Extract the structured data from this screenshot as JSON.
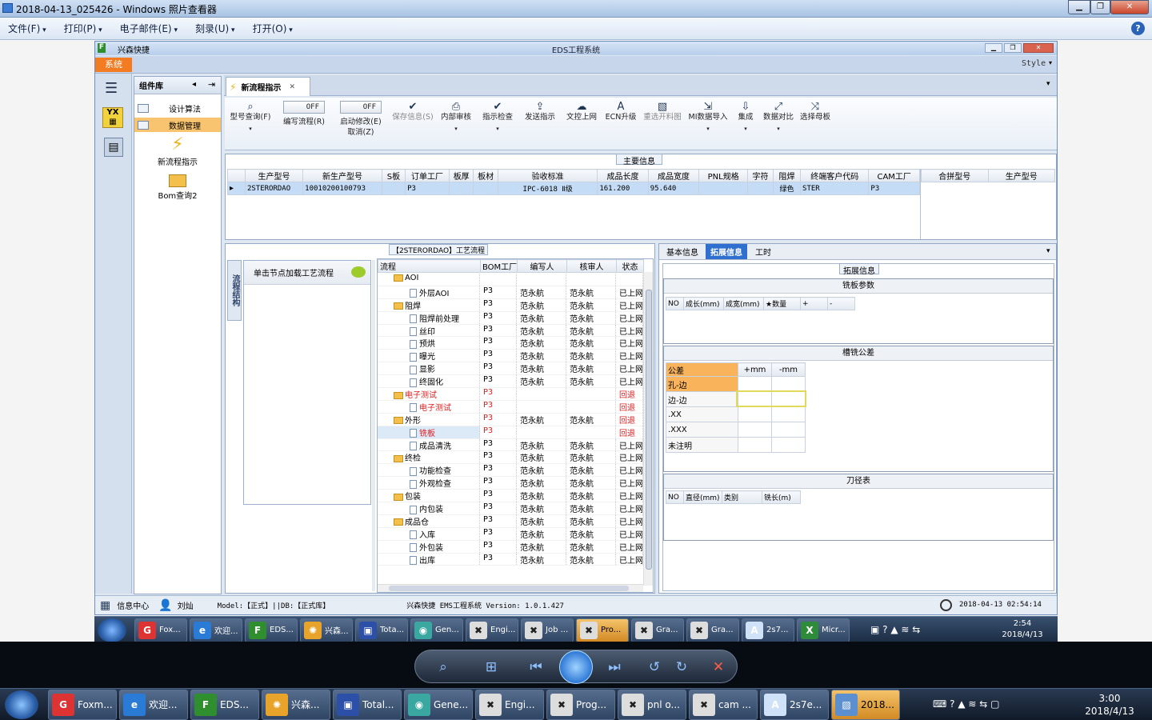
{
  "viewer": {
    "title": "2018-04-13_025426 - Windows 照片查看器",
    "menu": [
      "文件(F)",
      "打印(P)",
      "电子邮件(E)",
      "刻录(U)",
      "打开(O)"
    ],
    "help": "?"
  },
  "app": {
    "title": "EDS工程系统",
    "brand": "兴森快捷",
    "sys_tab": "系统",
    "style_label": "Style",
    "nav_title": "组件库",
    "nav_items": [
      "设计算法",
      "数据管理"
    ],
    "nav_tiles": [
      "新流程指示",
      "Bom查询2"
    ],
    "doc_tab": "新流程指示",
    "toolbar": [
      {
        "label": "型号查询(F)",
        "icon": "search-icon"
      },
      {
        "label": "编写流程(R)",
        "toggle": "OFF"
      },
      {
        "label": "启动修改(E)\n取消(Z)",
        "toggle": "OFF"
      },
      {
        "label": "保存信息(S)",
        "icon": "check-icon"
      },
      {
        "label": "内部审核",
        "icon": "print-icon"
      },
      {
        "label": "指示检查",
        "icon": "check-icon"
      },
      {
        "label": "发送指示",
        "icon": "upload-icon"
      },
      {
        "label": "文控上网",
        "icon": "cloud-icon"
      },
      {
        "label": "ECN升级",
        "icon": "font-icon"
      },
      {
        "label": "重选开料图",
        "icon": "image-icon"
      },
      {
        "label": "MI数据导入",
        "icon": "import-icon"
      },
      {
        "label": "集成",
        "icon": "download-icon"
      },
      {
        "label": "数据对比",
        "icon": "compare-icon"
      },
      {
        "label": "选择母板",
        "icon": "shuffle-icon"
      }
    ],
    "main_info": {
      "title": "主要信息",
      "columns": [
        "生产型号",
        "新生产型号",
        "S板",
        "订单工厂",
        "板厚",
        "板材",
        "验收标准",
        "成品长度",
        "成品宽度",
        "PNL规格",
        "字符",
        "阻焊",
        "终端客户代码",
        "CAM工厂"
      ],
      "row": [
        "2STERORDAO",
        "10010200100793",
        "",
        "P3",
        "",
        "",
        "IPC-6018 Ⅱ级",
        "161.200",
        "95.640",
        "",
        "",
        "绿色",
        "STER",
        "P3"
      ],
      "side_columns": [
        "合拼型号",
        "生产型号"
      ]
    },
    "process": {
      "title": "【2STERORDAO】工艺流程",
      "side_tab": "流程结构",
      "hint": "单击节点加载工艺流程",
      "columns": [
        "流程",
        "BOM工厂",
        "编写人",
        "核审人",
        "状态"
      ],
      "rows": [
        {
          "name": "AOI",
          "level": 0,
          "folder": true,
          "bom": "",
          "writer": "",
          "checker": "",
          "status": ""
        },
        {
          "name": "外层AOI",
          "level": 1,
          "bom": "P3",
          "writer": "范永航",
          "checker": "范永航",
          "status": "已上网"
        },
        {
          "name": "阻焊",
          "level": 0,
          "folder": true,
          "bom": "P3",
          "writer": "范永航",
          "checker": "范永航",
          "status": "已上网"
        },
        {
          "name": "阻焊前处理",
          "level": 1,
          "bom": "P3",
          "writer": "范永航",
          "checker": "范永航",
          "status": "已上网"
        },
        {
          "name": "丝印",
          "level": 1,
          "bom": "P3",
          "writer": "范永航",
          "checker": "范永航",
          "status": "已上网"
        },
        {
          "name": "预烘",
          "level": 1,
          "bom": "P3",
          "writer": "范永航",
          "checker": "范永航",
          "status": "已上网"
        },
        {
          "name": "曝光",
          "level": 1,
          "bom": "P3",
          "writer": "范永航",
          "checker": "范永航",
          "status": "已上网"
        },
        {
          "name": "显影",
          "level": 1,
          "bom": "P3",
          "writer": "范永航",
          "checker": "范永航",
          "status": "已上网"
        },
        {
          "name": "终固化",
          "level": 1,
          "bom": "P3",
          "writer": "范永航",
          "checker": "范永航",
          "status": "已上网"
        },
        {
          "name": "电子测试",
          "level": 0,
          "folder": true,
          "red": true,
          "bom": "P3",
          "writer": "",
          "checker": "",
          "status": "回退"
        },
        {
          "name": "电子测试",
          "level": 1,
          "red": true,
          "bom": "P3",
          "writer": "",
          "checker": "",
          "status": "回退"
        },
        {
          "name": "外形",
          "level": 0,
          "folder": true,
          "bom": "P3",
          "writer": "范永航",
          "checker": "范永航",
          "status": "回退"
        },
        {
          "name": "铣板",
          "level": 1,
          "red": true,
          "selected": true,
          "bom": "P3",
          "writer": "",
          "checker": "",
          "status": "回退"
        },
        {
          "name": "成品清洗",
          "level": 1,
          "bom": "P3",
          "writer": "范永航",
          "checker": "范永航",
          "status": "已上网"
        },
        {
          "name": "终检",
          "level": 0,
          "folder": true,
          "bom": "P3",
          "writer": "范永航",
          "checker": "范永航",
          "status": "已上网"
        },
        {
          "name": "功能检查",
          "level": 1,
          "bom": "P3",
          "writer": "范永航",
          "checker": "范永航",
          "status": "已上网"
        },
        {
          "name": "外观检查",
          "level": 1,
          "bom": "P3",
          "writer": "范永航",
          "checker": "范永航",
          "status": "已上网"
        },
        {
          "name": "包装",
          "level": 0,
          "folder": true,
          "bom": "P3",
          "writer": "范永航",
          "checker": "范永航",
          "status": "已上网"
        },
        {
          "name": "内包装",
          "level": 1,
          "bom": "P3",
          "writer": "范永航",
          "checker": "范永航",
          "status": "已上网"
        },
        {
          "name": "成品仓",
          "level": 0,
          "folder": true,
          "bom": "P3",
          "writer": "范永航",
          "checker": "范永航",
          "status": "已上网"
        },
        {
          "name": "入库",
          "level": 1,
          "bom": "P3",
          "writer": "范永航",
          "checker": "范永航",
          "status": "已上网"
        },
        {
          "name": "外包装",
          "level": 1,
          "bom": "P3",
          "writer": "范永航",
          "checker": "范永航",
          "status": "已上网"
        },
        {
          "name": "出库",
          "level": 1,
          "bom": "P3",
          "writer": "范永航",
          "checker": "范永航",
          "status": "已上网"
        }
      ]
    },
    "info_tabs": [
      "基本信息",
      "拓展信息",
      "工时"
    ],
    "ext_title": "拓展信息",
    "mill_params": {
      "title": "铣板参数",
      "columns": [
        "NO",
        "成长(mm)",
        "成宽(mm)",
        "★数量",
        "+",
        "-"
      ]
    },
    "tolerance": {
      "title": "槽铣公差",
      "columns": [
        "公差",
        "+mm",
        "-mm"
      ],
      "rows": [
        "孔-边",
        "边-边",
        ".XX",
        ".XXX",
        "未注明"
      ]
    },
    "tools": {
      "title": "刀径表",
      "columns": [
        "NO",
        "直径(mm)",
        "类别",
        "铣长(m)"
      ]
    },
    "status": {
      "info_center": "信息中心",
      "user": "刘灿",
      "model": "Model:【正式】||DB:【正式库】",
      "version": "兴森快捷 EMS工程系统 Version: 1.0.1.427",
      "datetime": "2018-04-13 02:54:14"
    }
  },
  "inner_taskbar": {
    "items": [
      "Fox...",
      "欢迎...",
      "EDS...",
      "兴森...",
      "Tota...",
      "Gen...",
      "Engi...",
      "Job ...",
      "Pro...",
      "Gra...",
      "Gra...",
      "2s7...",
      "Micr..."
    ],
    "time": "2:54",
    "date": "2018/4/13"
  },
  "taskbar": {
    "items": [
      "Foxm...",
      "欢迎...",
      "EDS...",
      "兴森...",
      "Total...",
      "Gene...",
      "Engi...",
      "Prog...",
      "pnl o...",
      "cam ...",
      "2s7e...",
      "2018..."
    ],
    "time": "3:00",
    "date": "2018/4/13"
  }
}
